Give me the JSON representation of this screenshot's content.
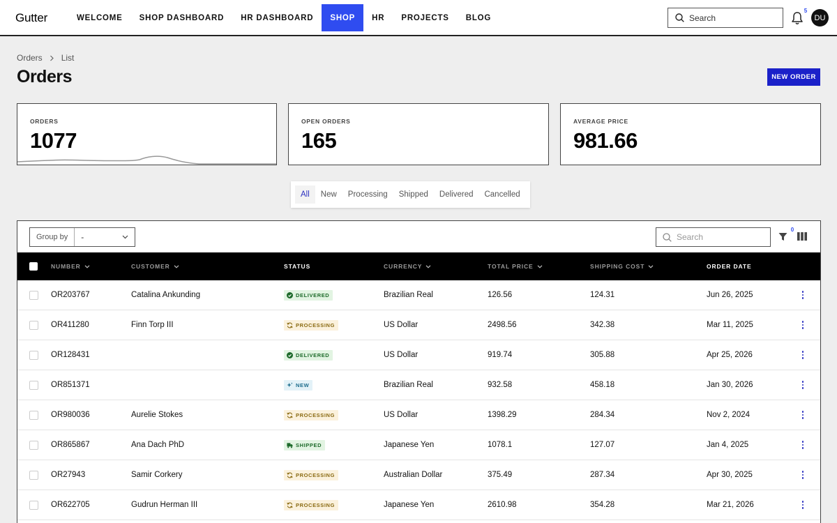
{
  "app": {
    "logo": "Gutter",
    "nav": [
      "WELCOME",
      "SHOP DASHBOARD",
      "HR DASHBOARD",
      "SHOP",
      "HR",
      "PROJECTS",
      "BLOG"
    ],
    "active_nav": "SHOP",
    "search_placeholder": "Search",
    "notification_count": "5",
    "user_initials": "DU",
    "accent_color": "#2f4cf0"
  },
  "breadcrumb": [
    "Orders",
    "List"
  ],
  "page_title": "Orders",
  "new_order_label": "NEW ORDER",
  "stats": [
    {
      "label": "ORDERS",
      "value": "1077"
    },
    {
      "label": "OPEN ORDERS",
      "value": "165"
    },
    {
      "label": "AVERAGE PRICE",
      "value": "981.66"
    }
  ],
  "tabs": [
    "All",
    "New",
    "Processing",
    "Shipped",
    "Delivered",
    "Cancelled"
  ],
  "active_tab": "All",
  "toolbar": {
    "group_by_label": "Group by",
    "group_by_value": "-",
    "search_placeholder": "Search",
    "filter_count": "0"
  },
  "columns": [
    "NUMBER",
    "CUSTOMER",
    "STATUS",
    "CURRENCY",
    "TOTAL PRICE",
    "SHIPPING COST",
    "ORDER DATE"
  ],
  "rows": [
    {
      "number": "OR203767",
      "customer": "Catalina Ankunding",
      "status": "DELIVERED",
      "currency": "Brazilian Real",
      "total": "126.56",
      "shipping": "124.31",
      "date": "Jun 26, 2025"
    },
    {
      "number": "OR411280",
      "customer": "Finn Torp III",
      "status": "PROCESSING",
      "currency": "US Dollar",
      "total": "2498.56",
      "shipping": "342.38",
      "date": "Mar 11, 2025"
    },
    {
      "number": "OR128431",
      "customer": "",
      "status": "DELIVERED",
      "currency": "US Dollar",
      "total": "919.74",
      "shipping": "305.88",
      "date": "Apr 25, 2026"
    },
    {
      "number": "OR851371",
      "customer": "",
      "status": "NEW",
      "currency": "Brazilian Real",
      "total": "932.58",
      "shipping": "458.18",
      "date": "Jan 30, 2026"
    },
    {
      "number": "OR980036",
      "customer": "Aurelie Stokes",
      "status": "PROCESSING",
      "currency": "US Dollar",
      "total": "1398.29",
      "shipping": "284.34",
      "date": "Nov 2, 2024"
    },
    {
      "number": "OR865867",
      "customer": "Ana Dach PhD",
      "status": "SHIPPED",
      "currency": "Japanese Yen",
      "total": "1078.1",
      "shipping": "127.07",
      "date": "Jan 4, 2025"
    },
    {
      "number": "OR27943",
      "customer": "Samir Corkery",
      "status": "PROCESSING",
      "currency": "Australian Dollar",
      "total": "375.49",
      "shipping": "287.34",
      "date": "Apr 30, 2025"
    },
    {
      "number": "OR622705",
      "customer": "Gudrun Herman III",
      "status": "PROCESSING",
      "currency": "Japanese Yen",
      "total": "2610.98",
      "shipping": "354.28",
      "date": "Mar 21, 2026"
    }
  ]
}
